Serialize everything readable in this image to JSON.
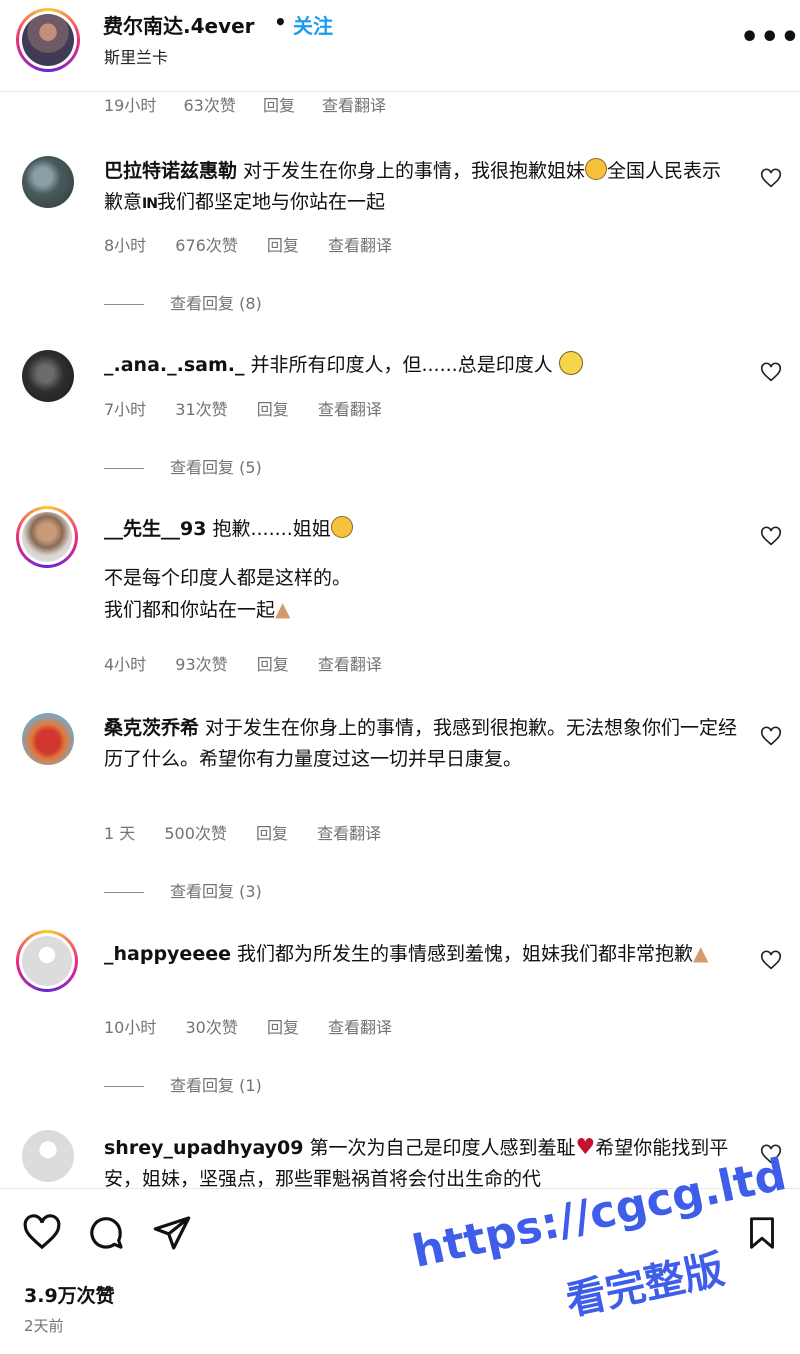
{
  "header": {
    "username": "费尔南达.4ever",
    "dot": "•",
    "follow_label": "关注",
    "location": "斯里兰卡",
    "more_icon": "more-horizontal-icon",
    "more_label": "•••"
  },
  "top_meta": {
    "time": "19小时",
    "likes": "63次赞",
    "reply": "回复",
    "translate": "查看翻译"
  },
  "comments": [
    {
      "user": "巴拉特诺兹惠勒",
      "text": "对于发生在你身上的事情，我很抱歉姐妹",
      "text_after_emoji": "全国人民表示歉意",
      "in_mark": "IN",
      "text_end": "我们都坚定地与你站在一起",
      "time": "8小时",
      "likes": "676次赞",
      "reply": "回复",
      "translate": "查看翻译",
      "replies": "查看回复 (8)"
    },
    {
      "user": "_.ana._.sam._",
      "text": "并非所有印度人，但......总是印度人",
      "time": "7小时",
      "likes": "31次赞",
      "reply": "回复",
      "translate": "查看翻译",
      "replies": "查看回复 (5)"
    },
    {
      "user": "__先生__93",
      "text": "抱歉.......姐姐",
      "line2": "不是每个印度人都是这样的。",
      "line3": "我们都和你站在一起",
      "time": "4小时",
      "likes": "93次赞",
      "reply": "回复",
      "translate": "查看翻译"
    },
    {
      "user": "桑克茨乔希",
      "text": "对于发生在你身上的事情，我感到很抱歉。无法想象你们一定经历了什么。希望你有力量度过这一切并早日康复。",
      "time": "1 天",
      "likes": "500次赞",
      "reply": "回复",
      "translate": "查看翻译",
      "replies": "查看回复 (3)"
    },
    {
      "user": "_happyeeee",
      "text": "我们都为所发生的事情感到羞愧，姐妹我们都非常抱歉",
      "time": "10小时",
      "likes": "30次赞",
      "reply": "回复",
      "translate": "查看翻译",
      "replies": "查看回复 (1)"
    },
    {
      "user": "shrey_upadhyay09",
      "text": "第一次为自己是印度人感到羞耻",
      "text_after_emoji": "希望你能找到平安，姐妹，坚强点，那些罪魁祸首将会付出生命的代"
    }
  ],
  "footer": {
    "like_icon": "heart-icon",
    "comment_icon": "comment-icon",
    "share_icon": "send-icon",
    "save_icon": "bookmark-icon",
    "likes": "3.9万次赞",
    "ago": "2天前"
  },
  "watermark": {
    "url": "https://cgcg.ltd",
    "label": "看完整版"
  },
  "colors": {
    "accent": "#1d9bf0",
    "muted": "#737373",
    "watermark": "#3e5de8"
  }
}
